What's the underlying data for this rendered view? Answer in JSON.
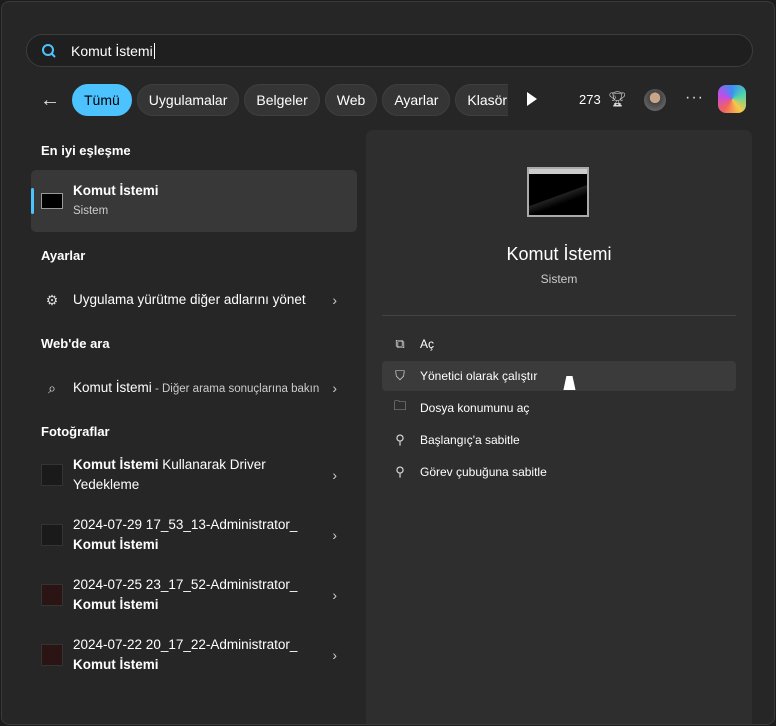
{
  "search": {
    "value": "Komut İstemi"
  },
  "filters": [
    "Tümü",
    "Uygulamalar",
    "Belgeler",
    "Web",
    "Ayarlar",
    "Klasörler"
  ],
  "points": "273",
  "left": {
    "best_match_header": "En iyi eşleşme",
    "best": {
      "title": "Komut İstemi",
      "sub": "Sistem"
    },
    "settings_header": "Ayarlar",
    "settings_item": "Uygulama yürütme diğer adlarını yönet",
    "web_header": "Web'de ara",
    "web_item": {
      "title": "Komut İstemi",
      "suffix": " - Diğer arama sonuçlarına bakın"
    },
    "photos_header": "Fotoğraflar",
    "photos": [
      {
        "bold": "Komut İstemi",
        "rest": " Kullanarak Driver Yedekleme"
      },
      {
        "pre": "2024-07-29 17_53_13-Administrator_ ",
        "bold": "Komut İstemi"
      },
      {
        "pre": "2024-07-25 23_17_52-Administrator_ ",
        "bold": "Komut İstemi"
      },
      {
        "pre": "2024-07-22 20_17_22-Administrator_ ",
        "bold": "Komut İstemi"
      }
    ]
  },
  "right": {
    "title": "Komut İstemi",
    "sub": "Sistem",
    "actions": [
      "Aç",
      "Yönetici olarak çalıştır",
      "Dosya konumunu aç",
      "Başlangıç'a sabitle",
      "Görev çubuğuna sabitle"
    ]
  },
  "colors": {
    "accent": "#4cc2ff"
  }
}
